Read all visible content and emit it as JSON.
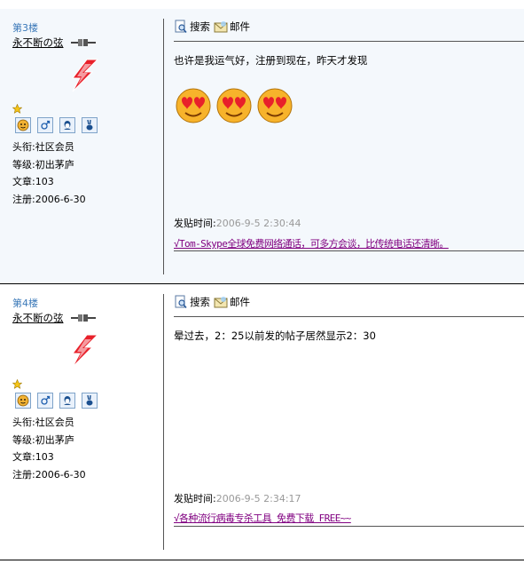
{
  "posts": [
    {
      "floor": "第3楼",
      "username": "永不断の弦",
      "title_label": "头衔:",
      "title_value": "社区会员",
      "level_label": "等级:",
      "level_value": "初出茅庐",
      "articles_label": "文章:",
      "articles_value": "103",
      "register_label": "注册:",
      "register_value": "2006-6-30",
      "search_label": "搜索",
      "mail_label": "邮件",
      "message": "也许是我运气好，注册到现在，昨天才发现",
      "smiley_count": 3,
      "time_label": "发贴时间:",
      "time_value": "2006-9-5 2:30:44",
      "ad_link": "√Tom-Skype全球免费网络通话，可多方会谈，比传统电话还清晰。"
    },
    {
      "floor": "第4楼",
      "username": "永不断の弦",
      "title_label": "头衔:",
      "title_value": "社区会员",
      "level_label": "等级:",
      "level_value": "初出茅庐",
      "articles_label": "文章:",
      "articles_value": "103",
      "register_label": "注册:",
      "register_value": "2006-6-30",
      "search_label": "搜索",
      "mail_label": "邮件",
      "message": "晕过去，2：25以前发的帖子居然显示2：30",
      "smiley_count": 0,
      "time_label": "发贴时间:",
      "time_value": "2006-9-5 2:34:17",
      "ad_link": "√各种流行病毒专杀工具 免费下载 FREE~~"
    }
  ],
  "icons": {
    "cable": "online-plug-icon",
    "logo": "red-lightning-logo",
    "star": "rank-star-icon",
    "badges": [
      "face-icon",
      "gender-male-icon",
      "qq-icon",
      "rabbit-zodiac-icon"
    ],
    "search": "search-icon",
    "mail": "mail-icon",
    "smiley": "love-smiley-icon"
  },
  "colors": {
    "floor": "#3a78b8",
    "link": "#800080",
    "time": "#999999",
    "logo": "#e8202a"
  }
}
